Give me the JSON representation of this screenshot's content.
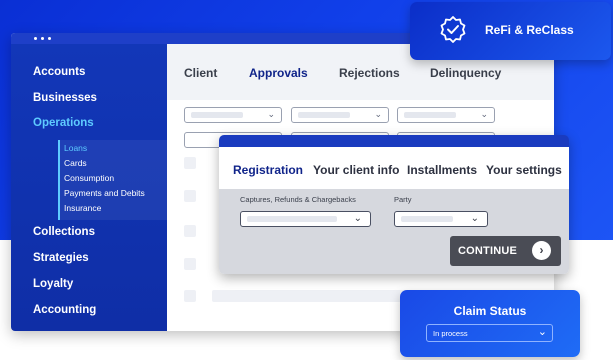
{
  "sidebar": {
    "items": [
      {
        "label": "Accounts"
      },
      {
        "label": "Businesses"
      },
      {
        "label": "Operations"
      },
      {
        "label": "Collections"
      },
      {
        "label": "Strategies"
      },
      {
        "label": "Loyalty"
      },
      {
        "label": "Accounting"
      }
    ],
    "active_item": "Operations",
    "submenu": [
      {
        "label": "Loans"
      },
      {
        "label": "Cards"
      },
      {
        "label": "Consumption"
      },
      {
        "label": "Payments and Debits"
      },
      {
        "label": "Insurance"
      }
    ],
    "active_subitem": "Loans"
  },
  "tabs": [
    {
      "label": "Client"
    },
    {
      "label": "Approvals"
    },
    {
      "label": "Rejections"
    },
    {
      "label": "Delinquency"
    }
  ],
  "active_tab": "Approvals",
  "registration_panel": {
    "tabs": [
      {
        "label": "Registration"
      },
      {
        "label": "Your client info"
      },
      {
        "label": "Installments"
      },
      {
        "label": "Your settings"
      }
    ],
    "active_tab": "Registration",
    "fields": [
      {
        "label": "Captures, Refunds & Chargebacks"
      },
      {
        "label": "Party"
      }
    ],
    "continue_label": "CONTINUE",
    "continue_icon": "arrow-right-icon"
  },
  "refi_badge": {
    "label": "ReFi & ReClass",
    "icon": "verified-badge-icon"
  },
  "claim_status": {
    "title": "Claim Status",
    "value": "In process"
  },
  "colors": {
    "brand_blue": "#1140ea",
    "accent_cyan": "#5ecbff",
    "active_tab": "#10248a",
    "button_dark": "#4a4c55"
  }
}
